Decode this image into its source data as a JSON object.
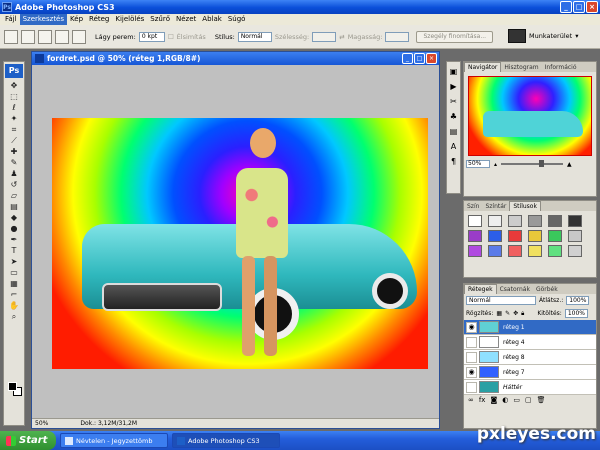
{
  "window": {
    "title": "Adobe Photoshop CS3"
  },
  "menu": [
    "Fájl",
    "Szerkesztés",
    "Kép",
    "Réteg",
    "Kijelölés",
    "Szűrő",
    "Nézet",
    "Ablak",
    "Súgó"
  ],
  "options": {
    "feather_label": "Lágy perem:",
    "feather_value": "0 kpt",
    "antialias_label": "Élsimítás",
    "style_label": "Stílus:",
    "style_value": "Normál",
    "width_label": "Szélesség:",
    "height_label": "Magasság:",
    "refine_button": "Szegély finomítása...",
    "workspace_label": "Munkaterület"
  },
  "document": {
    "title": "fordret.psd @ 50% (réteg 1,RGB/8#)",
    "zoom": "50%",
    "doc_info": "Dok.: 3,12M/31,2M"
  },
  "navigator": {
    "tabs": [
      "Navigátor",
      "Hisztogram",
      "Információ"
    ],
    "zoom": "50%"
  },
  "styles_panel": {
    "tabs": [
      "Szín",
      "Színtár",
      "Stílusok"
    ],
    "swatches": [
      "#ffffff",
      "#eeeeee",
      "#cccccc",
      "#999999",
      "#666666",
      "#333333",
      "#9a3cc8",
      "#2c5ee8",
      "#e83a3a",
      "#e8c83a",
      "#3ac85c",
      "#c8c8c8",
      "#b04ae0",
      "#5b7be8",
      "#f06060",
      "#f0e060",
      "#60e080",
      "#d0d0d0"
    ]
  },
  "layers": {
    "tabs": [
      "Rétegek",
      "Csatornák",
      "Görbék"
    ],
    "blend_mode": "Normál",
    "opacity_label": "Átlátsz.:",
    "opacity_value": "100%",
    "lock_label": "Rögzítés:",
    "fill_label": "Kitöltés:",
    "fill_value": "100%",
    "rows": [
      {
        "name": "réteg 1",
        "visible": true,
        "selected": true,
        "thumb": "#5fd0d4"
      },
      {
        "name": "réteg 4",
        "visible": false,
        "selected": false,
        "thumb": "#ffffff"
      },
      {
        "name": "réteg 8",
        "visible": false,
        "selected": false,
        "thumb": "#8fe0ff"
      },
      {
        "name": "réteg 7",
        "visible": true,
        "selected": false,
        "thumb": "#3060ff"
      },
      {
        "name": "Háttér",
        "visible": false,
        "selected": false,
        "thumb": "#2aa0a4"
      }
    ]
  },
  "taskbar": {
    "start": "Start",
    "tasks": [
      "Névtelen - Jegyzettömb",
      "Adobe Photoshop CS3"
    ]
  },
  "watermark": "pxleyes.com"
}
